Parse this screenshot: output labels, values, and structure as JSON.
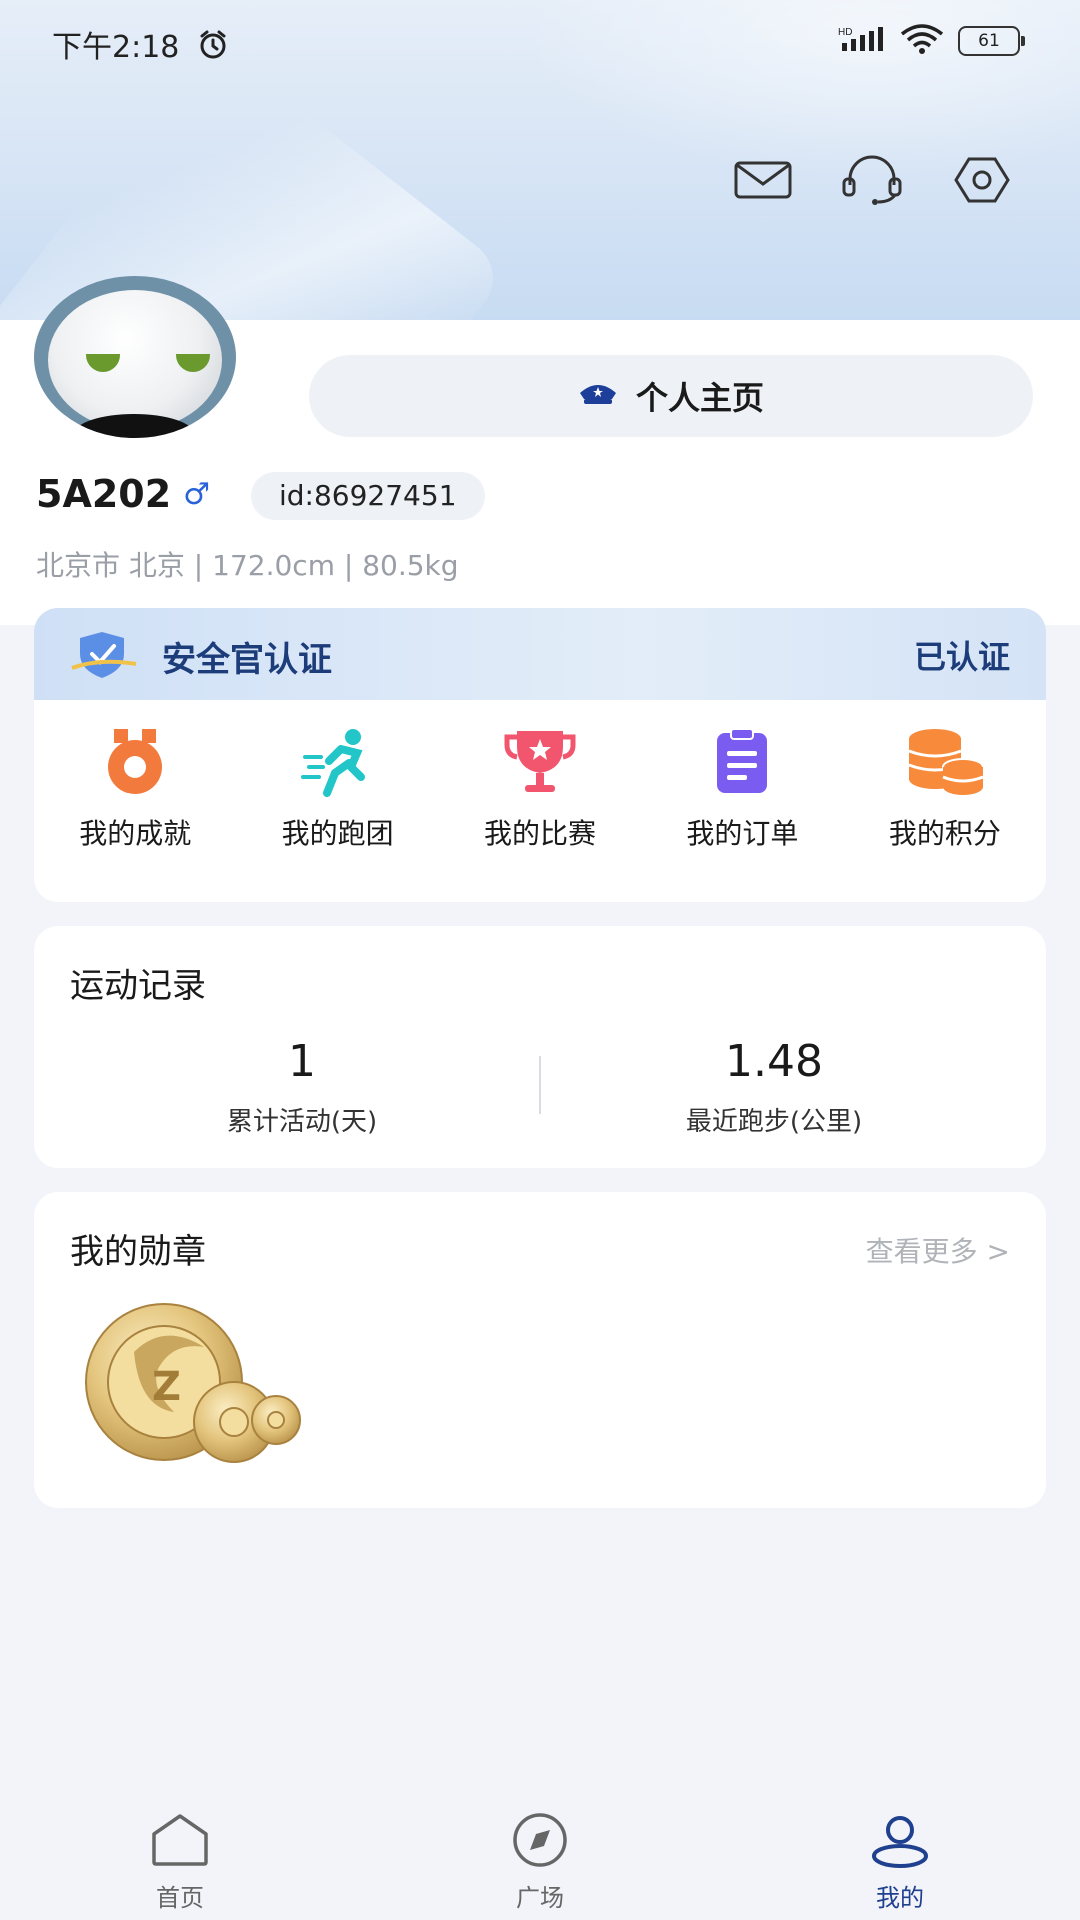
{
  "status_bar": {
    "time": "下午2:18",
    "battery": "61",
    "network": "HD"
  },
  "header": {
    "mail_icon": "mail-icon",
    "support_icon": "headset-icon",
    "settings_icon": "settings-icon"
  },
  "profile": {
    "homepage_label": "个人主页",
    "username": "5A202",
    "gender_symbol": "♂",
    "id": "id:86927451",
    "info": "北京市 北京 | 172.0cm | 80.5kg"
  },
  "certification": {
    "title": "安全官认证",
    "status": "已认证"
  },
  "services": [
    {
      "label": "我的成就",
      "icon": "medal-icon"
    },
    {
      "label": "我的跑团",
      "icon": "runner-icon"
    },
    {
      "label": "我的比赛",
      "icon": "trophy-icon"
    },
    {
      "label": "我的订单",
      "icon": "clipboard-icon"
    },
    {
      "label": "我的积分",
      "icon": "coins-icon"
    }
  ],
  "records": {
    "title": "运动记录",
    "cumulative_value": "1",
    "cumulative_label": "累计活动(天)",
    "recent_value": "1.48",
    "recent_label": "最近跑步(公里)"
  },
  "medals": {
    "title": "我的勋章",
    "more": "查看更多 >"
  },
  "nav": [
    {
      "label": "首页",
      "icon": "home-icon"
    },
    {
      "label": "广场",
      "icon": "compass-icon"
    },
    {
      "label": "我的",
      "icon": "user-icon"
    }
  ],
  "colors": {
    "accent": "#1f3f8f",
    "background": "#f2f4f9"
  }
}
